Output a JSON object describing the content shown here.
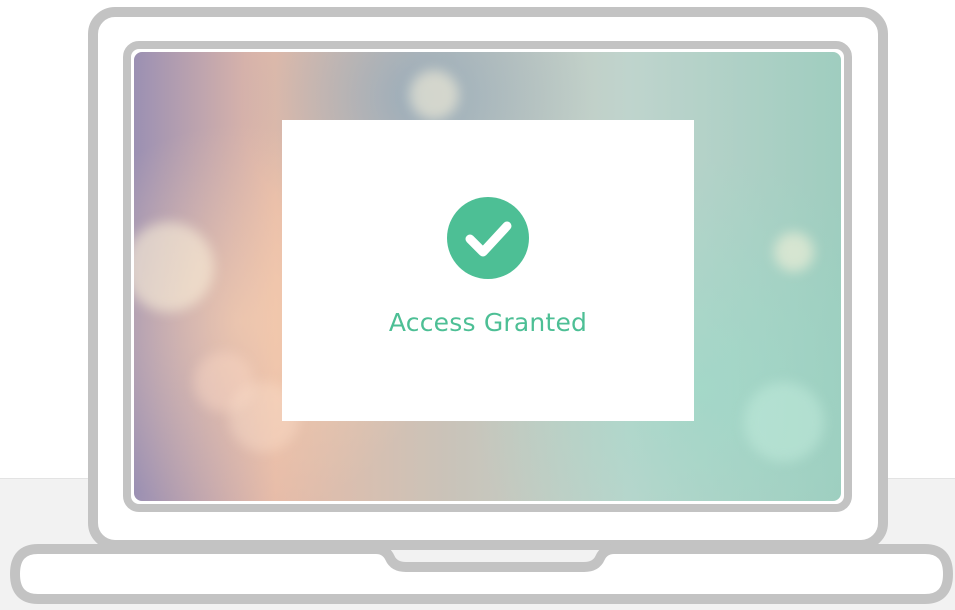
{
  "dialog": {
    "status_text": "Access Granted",
    "status_icon": "check-circle-icon",
    "accent_color": "#4dbf95"
  },
  "device": {
    "type": "laptop",
    "frame_color": "#bdbdbd"
  }
}
